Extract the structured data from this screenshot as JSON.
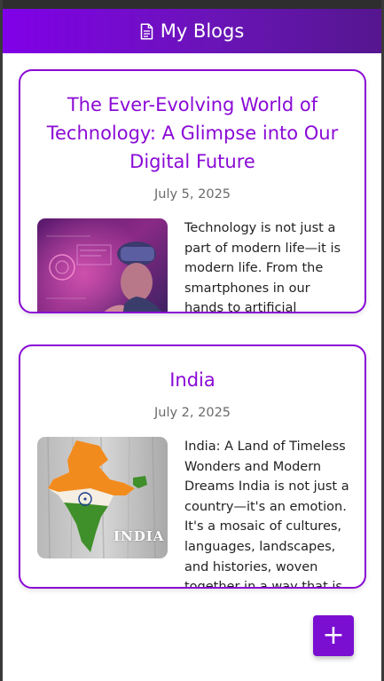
{
  "header": {
    "title": "My Blogs",
    "icon": "document-icon"
  },
  "posts": [
    {
      "title": "The Ever-Evolving World of Technology: A Glimpse into Our Digital Future",
      "date": "July 5, 2025",
      "excerpt": "Technology is not just a part of modern life—it is modern life. From the smartphones in our hands to artificial intelligence"
    },
    {
      "title": "India",
      "date": "July 2, 2025",
      "excerpt": "India: A Land of Timeless Wonders and Modern Dreams India is not just a country—it's an emotion. It's a mosaic of cultures, languages, landscapes, and histories, woven together in a way that is"
    }
  ],
  "thumb_india_text": "INDIA",
  "fab": {
    "label": "+"
  },
  "colors": {
    "accent": "#8a0ad6",
    "header_start": "#8000e8",
    "header_end": "#55168f"
  }
}
